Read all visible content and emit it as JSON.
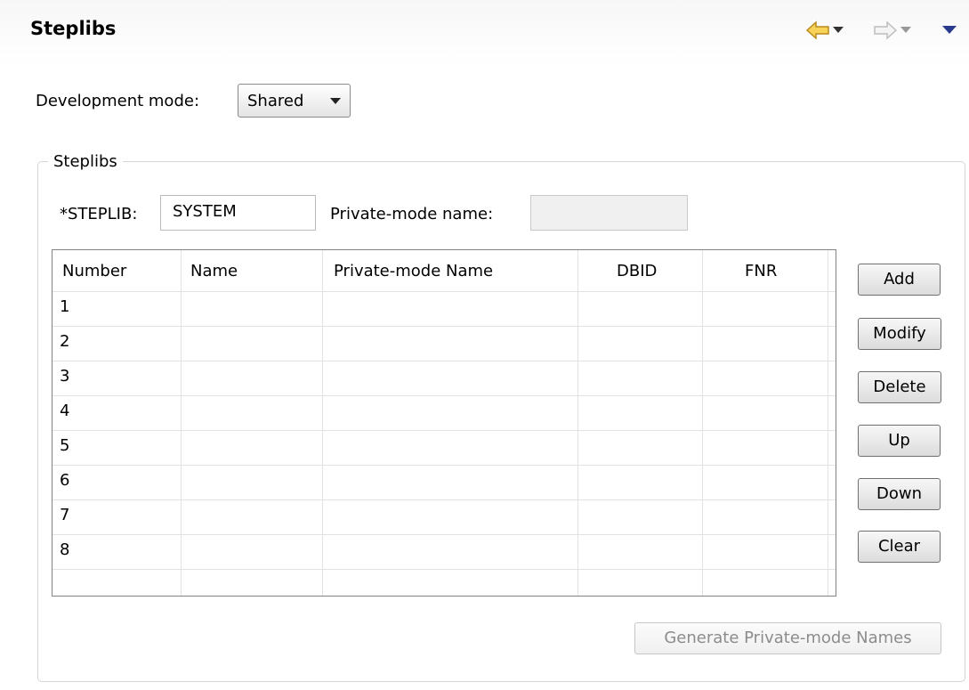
{
  "header": {
    "title": "Steplibs"
  },
  "mode": {
    "label": "Development mode:",
    "value": "Shared"
  },
  "group": {
    "title": "Steplibs",
    "steplib_label": "*STEPLIB:",
    "steplib_value": "SYSTEM",
    "private_label": "Private-mode name:",
    "private_value": ""
  },
  "table": {
    "columns": [
      "Number",
      "Name",
      "Private-mode Name",
      "DBID",
      "FNR"
    ],
    "rows": [
      [
        "1",
        "",
        "",
        "",
        ""
      ],
      [
        "2",
        "",
        "",
        "",
        ""
      ],
      [
        "3",
        "",
        "",
        "",
        ""
      ],
      [
        "4",
        "",
        "",
        "",
        ""
      ],
      [
        "5",
        "",
        "",
        "",
        ""
      ],
      [
        "6",
        "",
        "",
        "",
        ""
      ],
      [
        "7",
        "",
        "",
        "",
        ""
      ],
      [
        "8",
        "",
        "",
        "",
        ""
      ]
    ]
  },
  "buttons": {
    "add": "Add",
    "modify": "Modify",
    "delete": "Delete",
    "up": "Up",
    "down": "Down",
    "clear": "Clear",
    "generate": "Generate Private-mode Names"
  },
  "icons": {
    "back": "back-arrow-icon",
    "forward": "forward-arrow-icon",
    "menu": "view-menu-icon"
  },
  "colors": {
    "back_arrow": "#f5c842",
    "menu_arrow": "#2a3a8c"
  }
}
